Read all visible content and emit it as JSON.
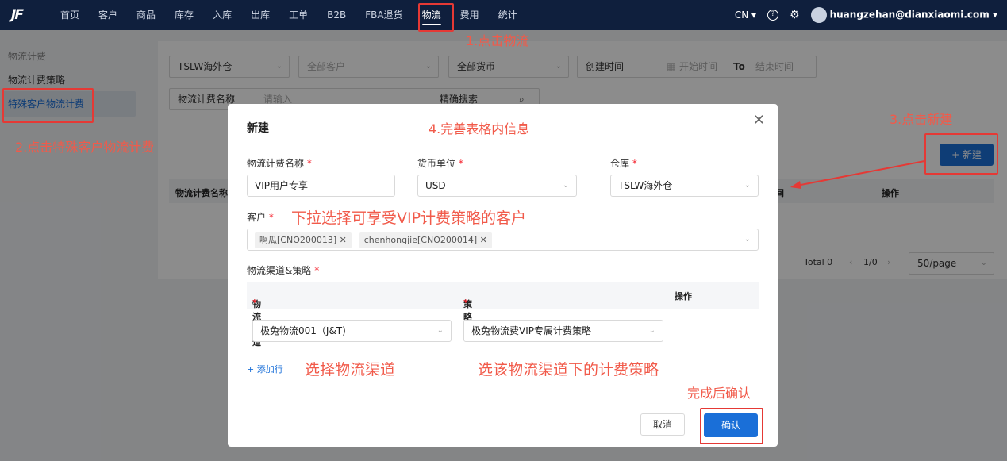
{
  "topbar": {
    "logo": "JF",
    "nav": [
      "首页",
      "客户",
      "商品",
      "库存",
      "入库",
      "出库",
      "工单",
      "B2B",
      "FBA退货",
      "物流",
      "费用",
      "统计"
    ],
    "active_nav": "物流",
    "lang": "CN ▾",
    "help_icon": "?",
    "user": "huangzehan@dianxiaomi.com ▾"
  },
  "sidebar": {
    "group": "物流计费",
    "items": [
      "物流计费策略",
      "特殊客户物流计费"
    ]
  },
  "filters": {
    "warehouse": "TSLW海外仓",
    "customer": "全部客户",
    "currency": "全部货币",
    "time_type": "创建时间",
    "start_time": "开始时间",
    "to": "To",
    "end_time": "结束时间",
    "name_field": "物流计费名称",
    "name_placeholder": "请输入",
    "search_mode": "精确搜索"
  },
  "table": {
    "col_name": "物流计费名称",
    "col_right": "间",
    "col_ops": "操作",
    "total": "Total 0",
    "page": "1/0",
    "page_size": "50/page"
  },
  "new_button": "+ 新建",
  "modal": {
    "title": "新建",
    "name_label": "物流计费名称",
    "name_value": "VIP用户专享",
    "currency_label": "货币单位",
    "currency_value": "USD",
    "warehouse_label": "仓库",
    "warehouse_value": "TSLW海外仓",
    "customer_label": "客户",
    "customer_tags": [
      "啊瓜[CNO200013]",
      "chenhongjie[CNO200014]"
    ],
    "channel_section_label": "物流渠道&策略",
    "col_channel": "物流渠道",
    "col_strategy": "策略",
    "col_ops": "操作",
    "channel_value": "极兔物流001（J&T)",
    "strategy_value": "极兔物流费VIP专属计费策略",
    "add_row": "+ 添加行",
    "cancel": "取消",
    "confirm": "确认"
  },
  "annotations": {
    "step1": "1.点击物流",
    "step2": "2.点击特殊客户物流计费",
    "step3": "3.点击新建",
    "step4": "4.完善表格内信息",
    "customer_tip": "下拉选择可享受VIP计费策略的客户",
    "channel_tip": "选择物流渠道",
    "strategy_tip": "选该物流渠道下的计费策略",
    "confirm_tip": "完成后确认"
  },
  "colors": {
    "primary": "#1a6fd8",
    "annotation": "#f15a4a",
    "topbar": "#0f1f3d"
  }
}
